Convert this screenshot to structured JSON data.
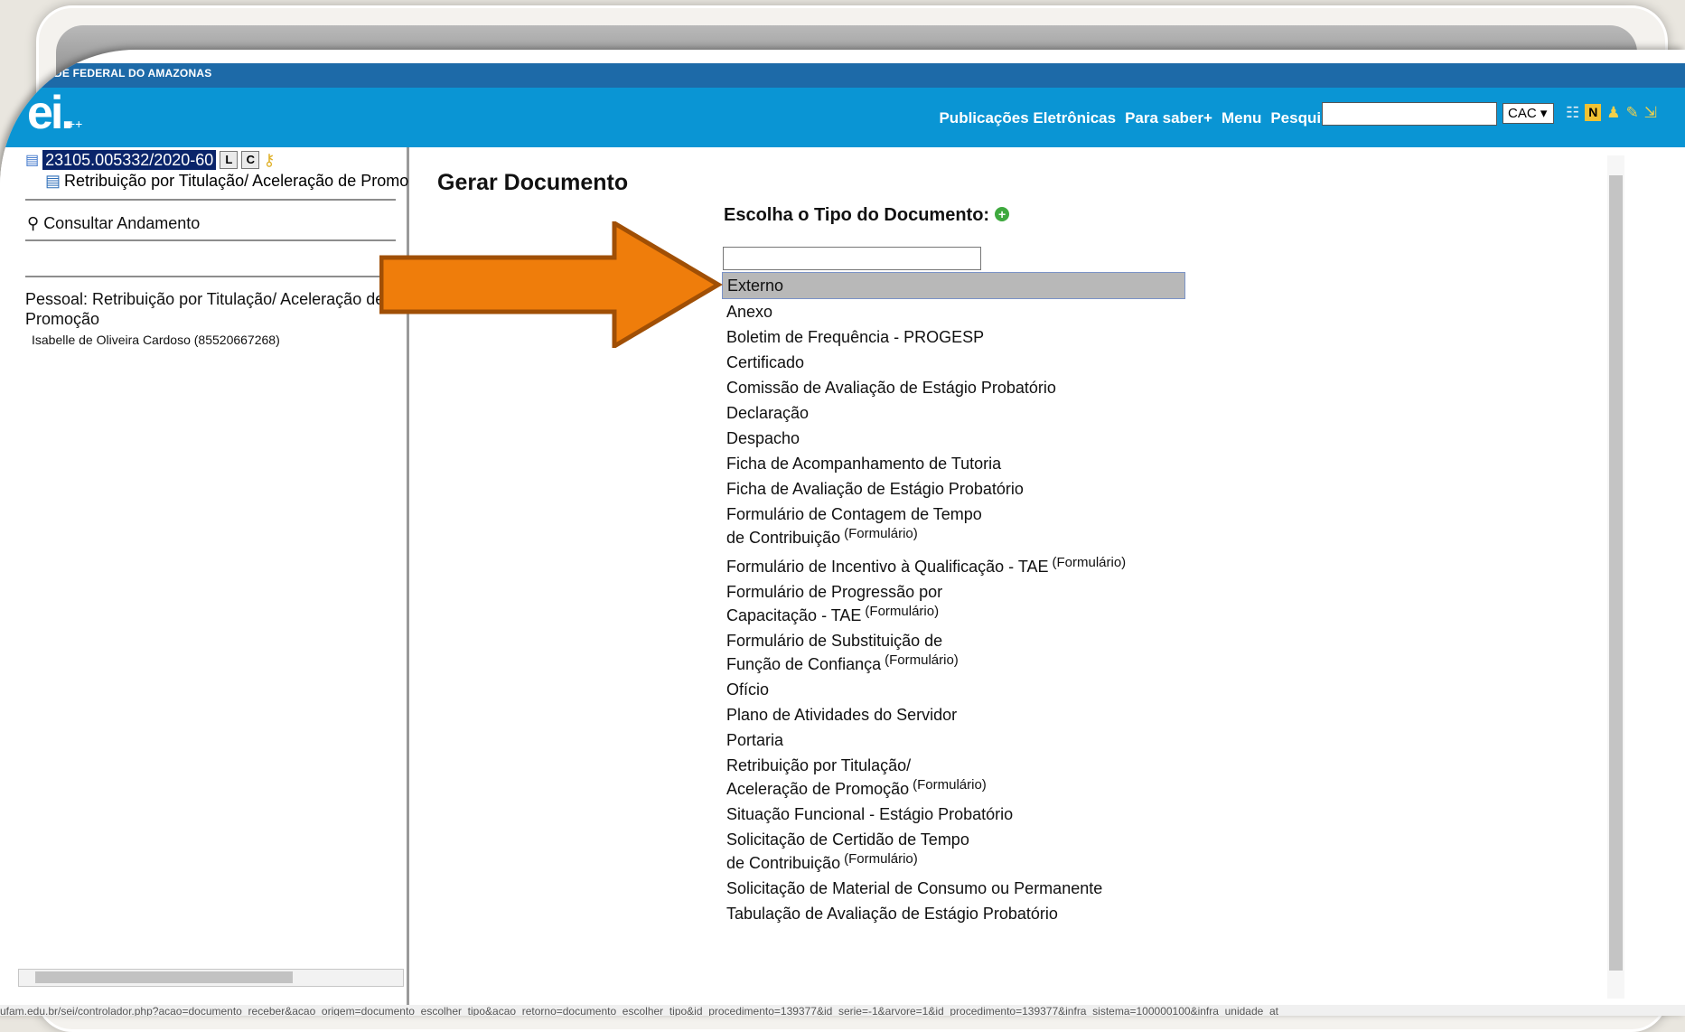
{
  "org_name": "DE FEDERAL DO AMAZONAS",
  "logo_text": "ei.",
  "logo_suffix": "++",
  "topnav": [
    "Publicações Eletrônicas",
    "Para saber+",
    "Menu",
    "Pesquisa"
  ],
  "unit_select": "CAC",
  "tree": {
    "process_number": "23105.005332/2020-60",
    "btn_l": "L",
    "btn_c": "C",
    "document_title": "Retribuição por Titulação/ Aceleração de Promo",
    "consult_label": "Consultar Andamento",
    "process_type": "Pessoal: Retribuição por Titulação/ Aceleração de Promoção",
    "interested": "Isabelle de Oliveira Cardoso (85520667268)"
  },
  "main": {
    "title": "Gerar Documento",
    "choose_label": "Escolha o Tipo do Documento:",
    "filter_value": "",
    "types": [
      {
        "label": "Externo",
        "tag": ""
      },
      {
        "label": "Anexo",
        "tag": ""
      },
      {
        "label": "Boletim de Frequência - PROGESP",
        "tag": ""
      },
      {
        "label": "Certificado",
        "tag": ""
      },
      {
        "label": "Comissão de Avaliação de Estágio Probatório",
        "tag": ""
      },
      {
        "label": "Declaração",
        "tag": ""
      },
      {
        "label": "Despacho",
        "tag": ""
      },
      {
        "label": "Ficha de Acompanhamento de Tutoria",
        "tag": ""
      },
      {
        "label": "Ficha de Avaliação de Estágio Probatório",
        "tag": ""
      },
      {
        "label": "Formulário de Contagem de Tempo de Contribuição",
        "tag": "(Formulário)"
      },
      {
        "label": "Formulário de Incentivo à Qualificação - TAE",
        "tag": "(Formulário)"
      },
      {
        "label": "Formulário de Progressão por Capacitação - TAE",
        "tag": "(Formulário)"
      },
      {
        "label": "Formulário de Substituição de Função de Confiança",
        "tag": "(Formulário)"
      },
      {
        "label": "Ofício",
        "tag": ""
      },
      {
        "label": "Plano de Atividades do Servidor",
        "tag": ""
      },
      {
        "label": "Portaria",
        "tag": ""
      },
      {
        "label": "Retribuição por Titulação/ Aceleração de Promoção",
        "tag": "(Formulário)"
      },
      {
        "label": "Situação Funcional - Estágio Probatório",
        "tag": ""
      },
      {
        "label": "Solicitação de Certidão de Tempo de Contribuição",
        "tag": "(Formulário)"
      },
      {
        "label": "Solicitação de Material de Consumo ou Permanente",
        "tag": ""
      },
      {
        "label": "Tabulação de Avaliação de Estágio Probatório",
        "tag": ""
      }
    ],
    "selected_index": 0
  },
  "status_url": "ufam.edu.br/sei/controlador.php?acao=documento_receber&acao_origem=documento_escolher_tipo&acao_retorno=documento_escolher_tipo&id_procedimento=139377&id_serie=-1&arvore=1&id_procedimento=139377&infra_sistema=100000100&infra_unidade_at",
  "colors": {
    "header": "#0a95d4",
    "org_band": "#1d6aa8",
    "arrow": "#ef7d0b",
    "arrow_border": "#a04f05"
  }
}
